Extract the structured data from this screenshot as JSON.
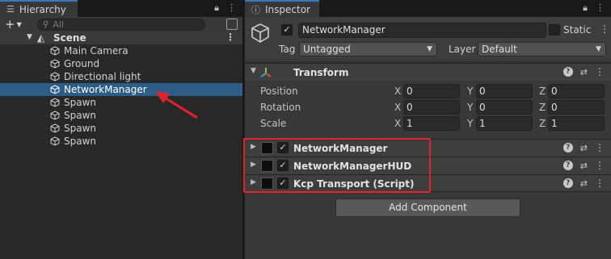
{
  "hierarchy": {
    "tab_title": "Hierarchy",
    "search_placeholder": "All",
    "scene_name": "Scene",
    "items": [
      {
        "label": "Main Camera",
        "selected": false
      },
      {
        "label": "Ground",
        "selected": false
      },
      {
        "label": "Directional light",
        "selected": false
      },
      {
        "label": "NetworkManager",
        "selected": true
      },
      {
        "label": "Spawn",
        "selected": false
      },
      {
        "label": "Spawn",
        "selected": false
      },
      {
        "label": "Spawn",
        "selected": false
      },
      {
        "label": "Spawn",
        "selected": false
      }
    ]
  },
  "inspector": {
    "tab_title": "Inspector",
    "object_name": "NetworkManager",
    "active_checked": true,
    "static_label": "Static",
    "static_checked": false,
    "tag_label": "Tag",
    "tag_value": "Untagged",
    "layer_label": "Layer",
    "layer_value": "Default",
    "transform": {
      "title": "Transform",
      "axes": [
        "X",
        "Y",
        "Z"
      ],
      "rows": [
        {
          "label": "Position",
          "values": [
            "0",
            "0",
            "0"
          ]
        },
        {
          "label": "Rotation",
          "values": [
            "0",
            "0",
            "0"
          ]
        },
        {
          "label": "Scale",
          "values": [
            "1",
            "1",
            "1"
          ]
        }
      ]
    },
    "components": [
      {
        "title": "NetworkManager",
        "checked": true
      },
      {
        "title": "NetworkManagerHUD",
        "checked": true
      },
      {
        "title": "Kcp Transport (Script)",
        "checked": true
      }
    ],
    "add_component_label": "Add Component"
  },
  "colors": {
    "selection": "#2c5d87",
    "highlight_box": "#e2232a",
    "tab_accent": "#3a79bb"
  }
}
